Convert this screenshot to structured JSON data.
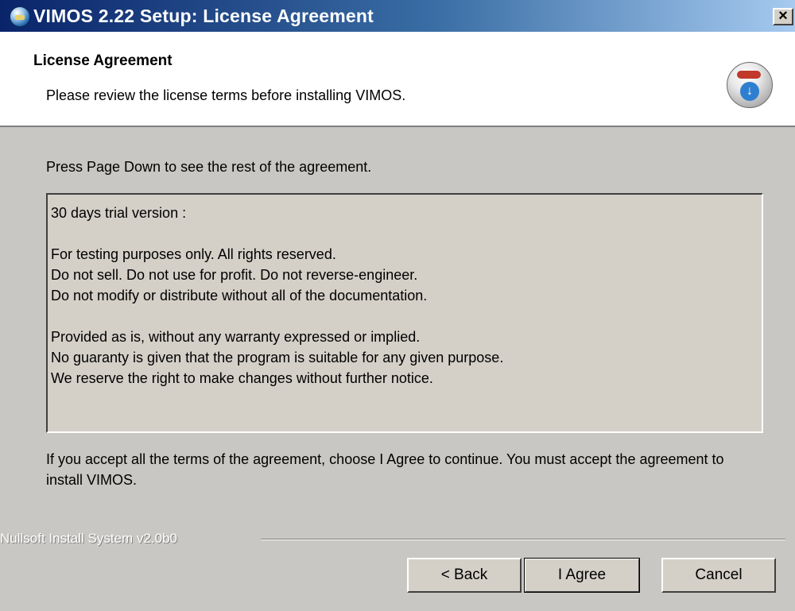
{
  "window": {
    "title": "VIMOS 2.22 Setup: License Agreement",
    "close_label": "×"
  },
  "header": {
    "title": "License Agreement",
    "subtitle": "Please review the license terms before installing VIMOS."
  },
  "body": {
    "instruction": "Press Page Down to see the rest of the agreement.",
    "license_lines": [
      "30 days trial version :",
      "",
      "For testing purposes only. All rights reserved.",
      "Do not sell. Do not use for profit. Do not reverse-engineer.",
      "Do not modify or distribute without all of the documentation.",
      "",
      "Provided as is, without any warranty expressed or implied.",
      "No guaranty is given that the program is suitable for any given purpose.",
      "We reserve the right to make changes without further notice."
    ],
    "accept_text": "If you accept all the terms of the agreement, choose I Agree to continue. You must accept the agreement to install VIMOS."
  },
  "footer": {
    "branding": "Nullsoft Install System v2.0b0",
    "back_label": "< Back",
    "agree_label": "I Agree",
    "cancel_label": "Cancel"
  },
  "icons": {
    "title_icon": "installer-globe-icon",
    "header_icon": "nsis-cd-install-icon"
  },
  "colors": {
    "titlebar_start": "#0a246a",
    "titlebar_end": "#a6caf0",
    "dialog_bg": "#d4d0c8",
    "header_bg": "#ffffff"
  }
}
